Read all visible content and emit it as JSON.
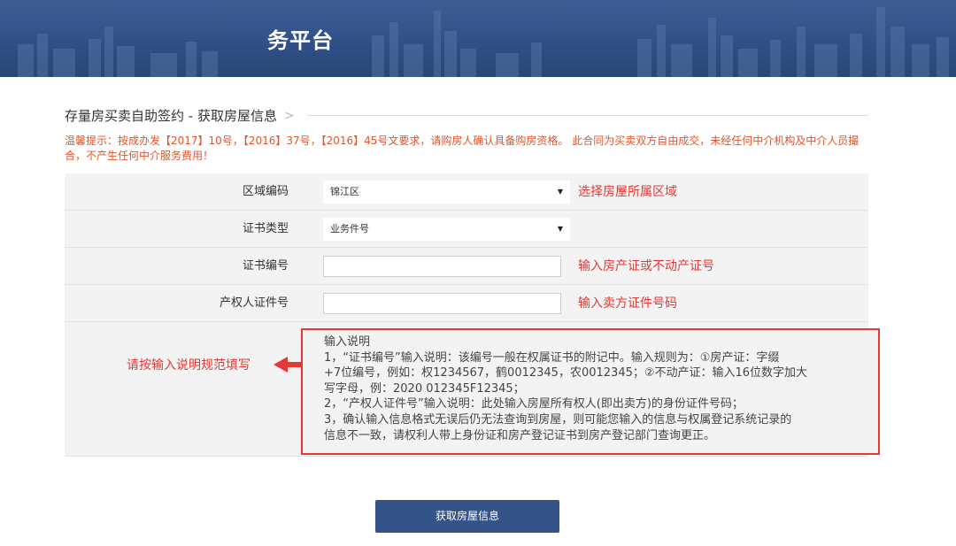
{
  "header": {
    "title": "务平台"
  },
  "breadcrumb": {
    "text": "存量房买卖自助签约 - 获取房屋信息",
    "separator": ">"
  },
  "notice": "温馨提示：按成办发【2017】10号，【2016】37号，【2016】45号文要求，请购房人确认具备购房资格。 此合同为买卖双方自由成交，未经任何中介机构及中介人员撮合，不产生任何中介服务费用！",
  "form": {
    "region": {
      "label": "区域编码",
      "value": "锦江区",
      "hint": "选择房屋所属区域"
    },
    "cert_type": {
      "label": "证书类型",
      "value": "业务件号"
    },
    "cert_no": {
      "label": "证书编号",
      "value": "",
      "hint": "输入房产证或不动产证号"
    },
    "owner_id": {
      "label": "产权人证件号",
      "value": "",
      "hint": "输入卖方证件号码"
    },
    "fill_tip": "请按输入说明规范填写",
    "explain": {
      "title": "输入说明",
      "lines": [
        "1，“证书编号”输入说明：该编号一般在权属证书的附记中。输入规则为：①房产证：字缀",
        "+7位编号，例如：权1234567，鹤0012345，农0012345；②不动产证：输入16位数字加大",
        "写字母，例：2020 012345F12345；",
        "2，“产权人证件号”输入说明：此处输入房屋所有权人(即出卖方)的身份证件号码；",
        "3，确认输入信息格式无误后仍无法查询到房屋，则可能您输入的信息与权属登记系统记录的",
        "信息不一致，请权利人带上身份证和房产登记证书到房产登记部门查询更正。"
      ]
    }
  },
  "submit_button": "获取房屋信息",
  "colors": {
    "banner": "#2f4f86",
    "accent_red": "#e53935",
    "notice_orange": "#e2552b",
    "button": "#345388"
  }
}
